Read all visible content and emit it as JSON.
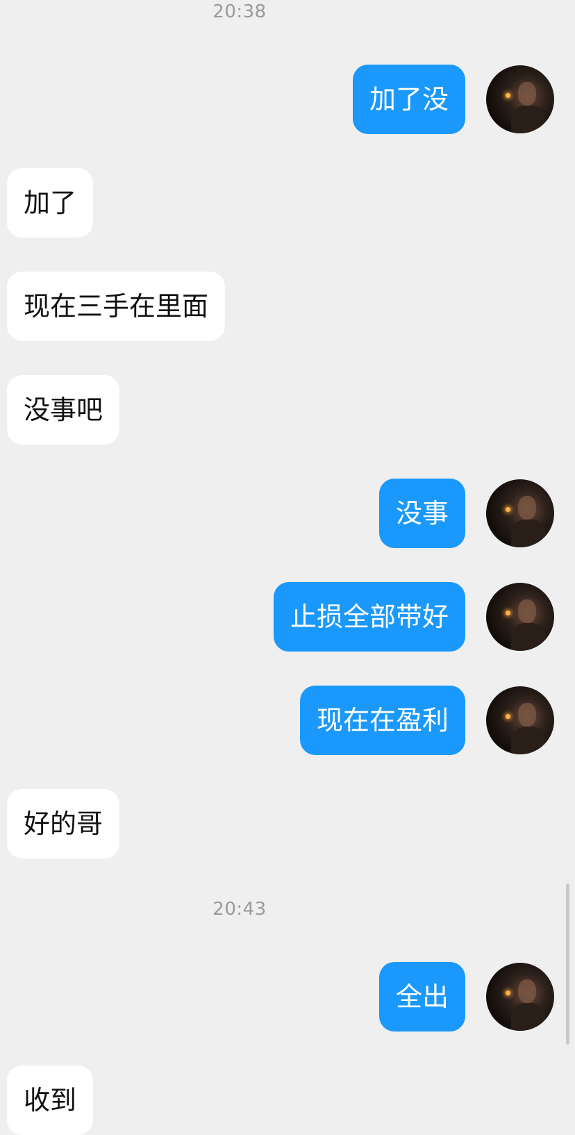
{
  "timestamps": [
    "20:38",
    "20:43"
  ],
  "messages": [
    {
      "side": "out",
      "text": "加了没"
    },
    {
      "side": "in",
      "text": "加了"
    },
    {
      "side": "in",
      "text": "现在三手在里面"
    },
    {
      "side": "in",
      "text": "没事吧"
    },
    {
      "side": "out",
      "text": "没事"
    },
    {
      "side": "out",
      "text": "止损全部带好"
    },
    {
      "side": "out",
      "text": "现在在盈利"
    },
    {
      "side": "in",
      "text": "好的哥"
    },
    {
      "side": "out",
      "text": "全出"
    },
    {
      "side": "in",
      "text": "收到"
    }
  ],
  "colors": {
    "background": "#efeff0",
    "outgoing_bubble": "#1a98fb",
    "incoming_bubble": "#ffffff",
    "timestamp_text": "#9a9a9c"
  },
  "icons": {
    "avatar": "user-avatar-photo"
  }
}
